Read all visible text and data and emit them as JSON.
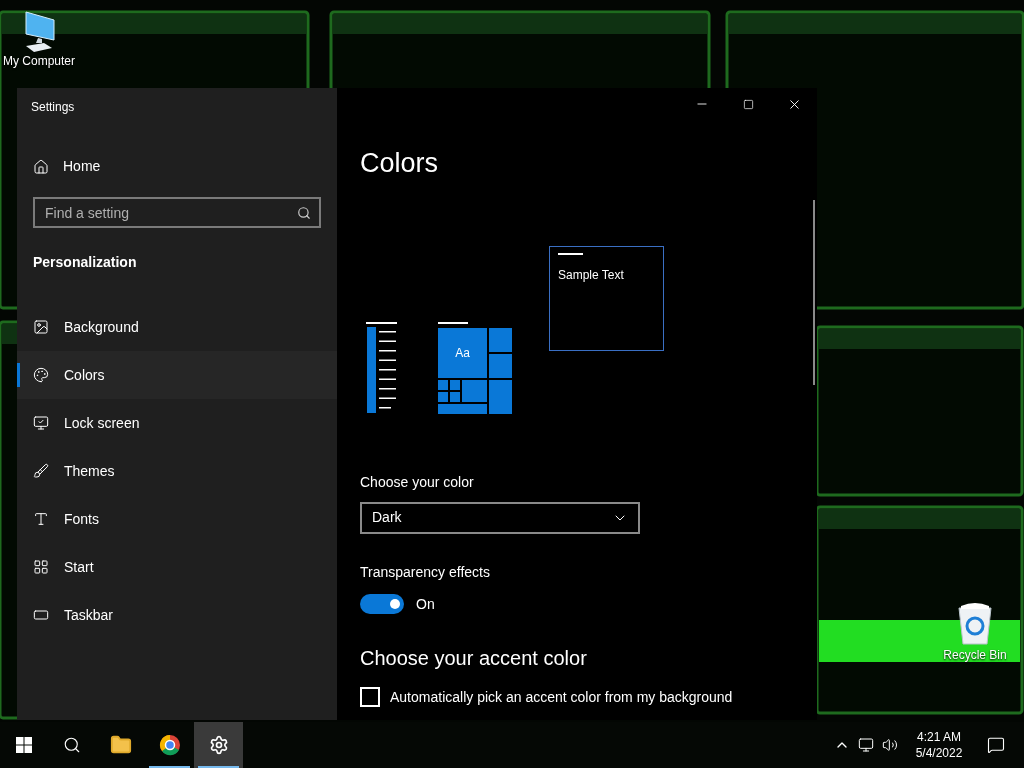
{
  "desktop_icons": [
    {
      "kind": "computer",
      "label": "My Computer"
    },
    {
      "kind": "recycle",
      "label": "Recycle Bin"
    }
  ],
  "window": {
    "title": "Settings"
  },
  "sidebar": {
    "home": "Home",
    "search": {
      "placeholder": "Find a setting"
    },
    "section": "Personalization",
    "items": [
      {
        "kind": "background",
        "label": "Background",
        "selected": false
      },
      {
        "kind": "colors",
        "label": "Colors",
        "selected": true
      },
      {
        "kind": "lock",
        "label": "Lock screen",
        "selected": false
      },
      {
        "kind": "themes",
        "label": "Themes",
        "selected": false
      },
      {
        "kind": "fonts",
        "label": "Fonts",
        "selected": false
      },
      {
        "kind": "start",
        "label": "Start",
        "selected": false
      },
      {
        "kind": "taskbar",
        "label": "Taskbar",
        "selected": false
      }
    ]
  },
  "page": {
    "title": "Colors",
    "preview": {
      "tile_text": "Aa",
      "sample_text": "Sample Text"
    },
    "color_label": "Choose your color",
    "color_value": "Dark",
    "transparency": {
      "label": "Transparency effects",
      "on": true,
      "state_text": "On"
    },
    "accent_heading": "Choose your accent color",
    "auto_accent": {
      "label": "Automatically pick an accent color from my background",
      "checked": false
    }
  },
  "taskbar": {
    "apps": [
      {
        "kind": "explorer",
        "open": false,
        "selected": false
      },
      {
        "kind": "browser",
        "open": true,
        "selected": false
      },
      {
        "kind": "settings",
        "open": true,
        "selected": true
      }
    ],
    "time": "4:21 AM",
    "date": "5/4/2022"
  }
}
